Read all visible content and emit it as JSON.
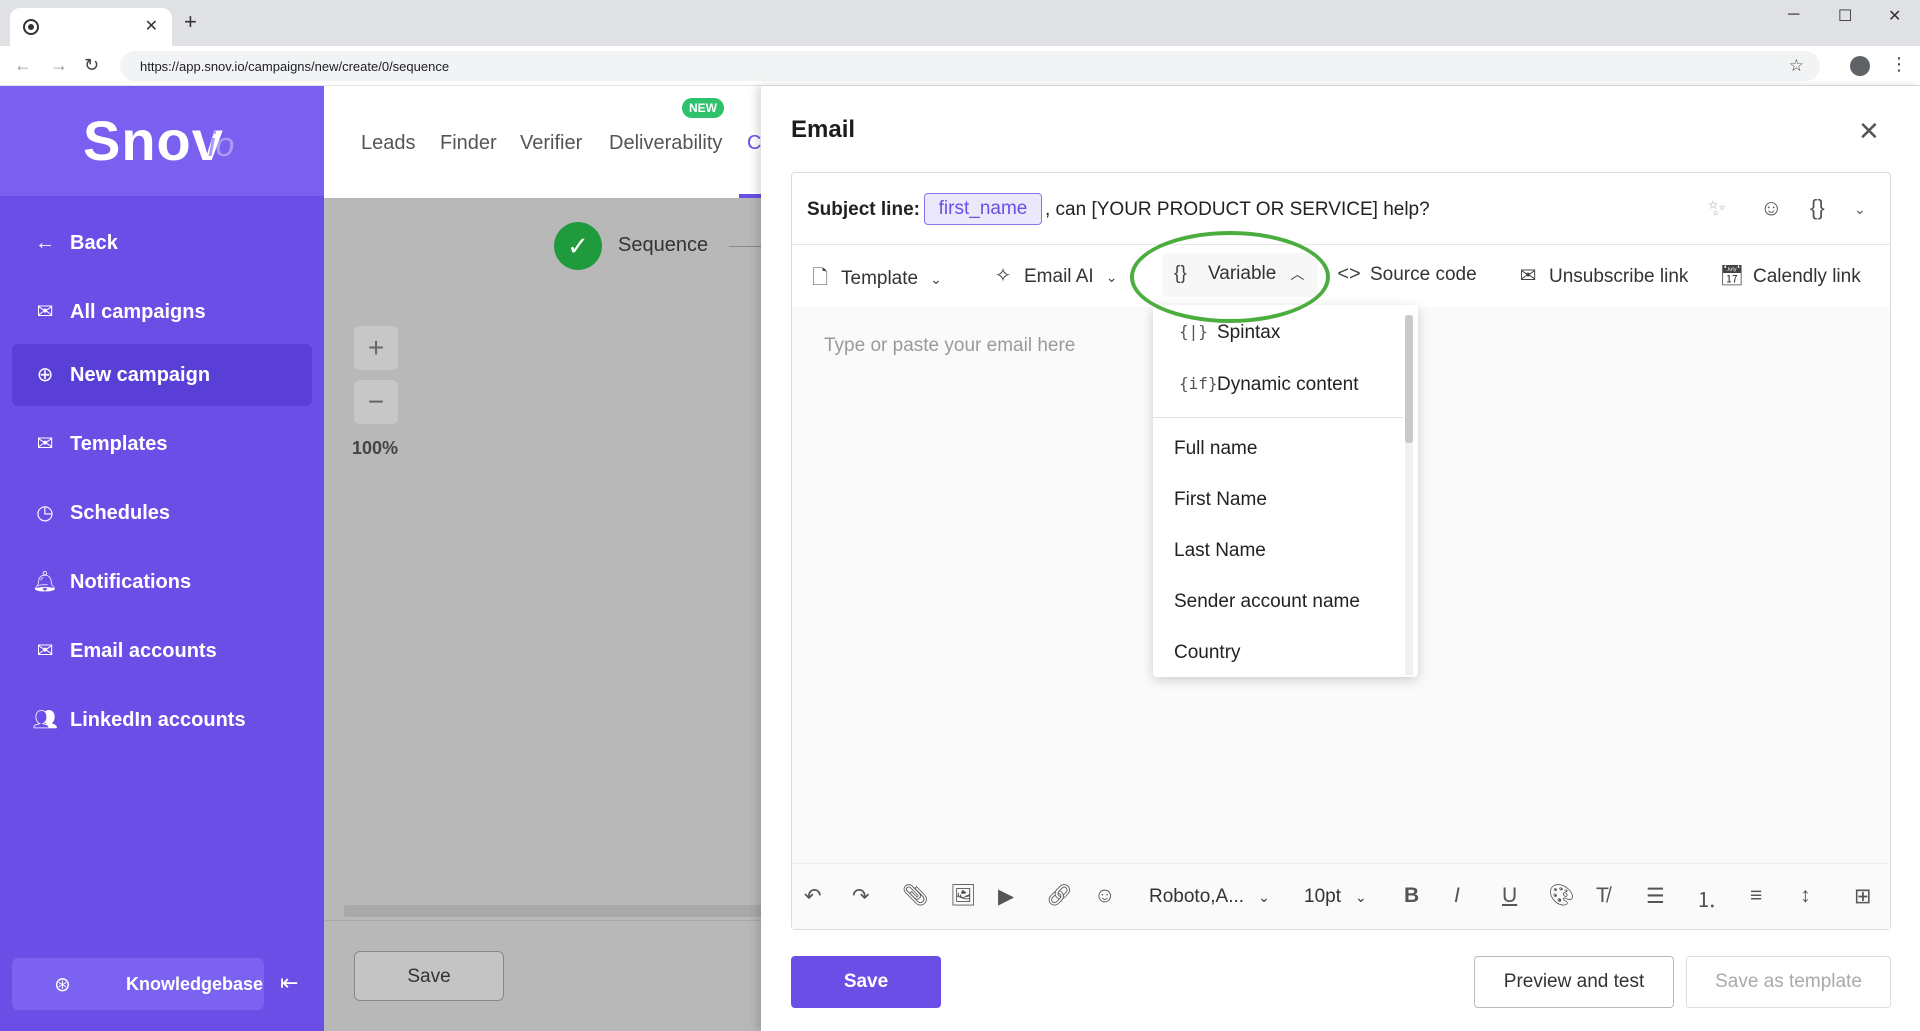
{
  "browser": {
    "tab_close": "✕",
    "new_tab": "+",
    "url": "https://app.snov.io/campaigns/new/create/0/sequence"
  },
  "sidebar": {
    "logo": "Snov",
    "logo_suffix": "io",
    "items": [
      {
        "label": "Back",
        "icon": "arrow-left-icon"
      },
      {
        "label": "All campaigns",
        "icon": "mail-icon"
      },
      {
        "label": "New campaign",
        "icon": "plus-circle-icon"
      },
      {
        "label": "Templates",
        "icon": "mail-template-icon"
      },
      {
        "label": "Schedules",
        "icon": "clock-icon"
      },
      {
        "label": "Notifications",
        "icon": "bell-icon"
      },
      {
        "label": "Email accounts",
        "icon": "mail-icon"
      },
      {
        "label": "LinkedIn accounts",
        "icon": "users-icon"
      }
    ],
    "knowledgebase": "Knowledgebase"
  },
  "topnav": {
    "items": [
      "Leads",
      "Finder",
      "Verifier",
      "Deliverability",
      "C"
    ],
    "new_badge": "NEW"
  },
  "canvas": {
    "step_label": "Sequence",
    "zoom": "100%",
    "save": "Save"
  },
  "modal": {
    "title": "Email",
    "subject_label": "Subject line:",
    "subject_variable": "first_name",
    "subject_text": ", can [YOUR PRODUCT OR SERVICE] help?",
    "toolbar": {
      "template": "Template",
      "email_ai": "Email AI",
      "variable": "Variable",
      "source_code": "Source code",
      "unsubscribe": "Unsubscribe link",
      "calendly": "Calendly link"
    },
    "body_placeholder": "Type or paste your email here",
    "format": {
      "font": "Roboto,A...",
      "size": "10pt"
    },
    "buttons": {
      "save": "Save",
      "preview": "Preview and test",
      "save_template": "Save as template"
    }
  },
  "variable_menu": {
    "special": [
      {
        "icon": "{|}",
        "label": "Spintax"
      },
      {
        "icon": "{if}",
        "label": "Dynamic content"
      }
    ],
    "items": [
      "Full name",
      "First Name",
      "Last Name",
      "Sender account name",
      "Country"
    ]
  },
  "colors": {
    "brand": "#6b4ee6",
    "highlight": "#4cad3f",
    "success": "#1f9a3d"
  }
}
